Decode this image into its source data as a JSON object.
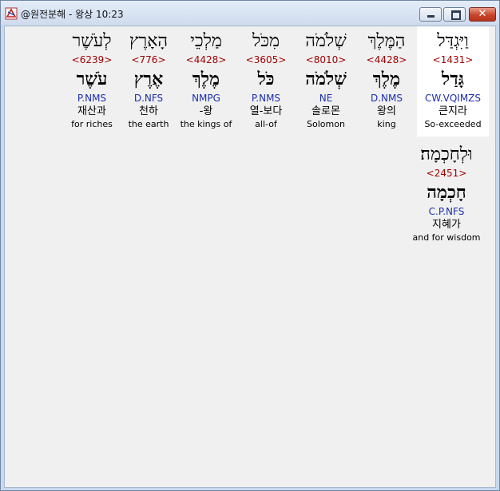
{
  "window": {
    "title": "@원전분해 - 왕상 10:23",
    "minimize_label": "",
    "maximize_label": "",
    "close_label": "✕"
  },
  "words": [
    {
      "hebrew": "וַיִּגְדַּל",
      "strongs": "<1431>",
      "lemma": "גָּדַל",
      "morph": "CW.VQIMZS",
      "korean": "큰지라",
      "english": "So-exceeded",
      "highlight": true
    },
    {
      "hebrew": "הַמֶּלֶךְ",
      "strongs": "<4428>",
      "lemma": "מֶלֶךְ",
      "morph": "D.NMS",
      "korean": "왕의",
      "english": "king",
      "highlight": false
    },
    {
      "hebrew": "שְׁלֹמֹה",
      "strongs": "<8010>",
      "lemma": "שְׁלֹמֹה",
      "morph": "NE",
      "korean": "솔로몬",
      "english": "Solomon",
      "highlight": false
    },
    {
      "hebrew": "מִכֹּל",
      "strongs": "<3605>",
      "lemma": "כֹּל",
      "morph": "P.NMS",
      "korean": "열-보다",
      "english": "all-of",
      "highlight": false
    },
    {
      "hebrew": "מַלְכֵי",
      "strongs": "<4428>",
      "lemma": "מֶלֶךְ",
      "morph": "NMPG",
      "korean": "-왕",
      "english": "the kings of",
      "highlight": false
    },
    {
      "hebrew": "הָאָרֶץ",
      "strongs": "<776>",
      "lemma": "אֶרֶץ",
      "morph": "D.NFS",
      "korean": "천하",
      "english": "the earth",
      "highlight": false
    },
    {
      "hebrew": "לְעֹשֶׁר",
      "strongs": "<6239>",
      "lemma": "עֹשֶׁר",
      "morph": "P.NMS",
      "korean": "재산과",
      "english": "for riches",
      "highlight": false
    },
    {
      "hebrew": "וּלְחָכְמָה׃",
      "strongs": "<2451>",
      "lemma": "חָכְמָה",
      "morph": "C.P.NFS",
      "korean": "지혜가",
      "english": "and for wisdom",
      "highlight": false
    }
  ]
}
